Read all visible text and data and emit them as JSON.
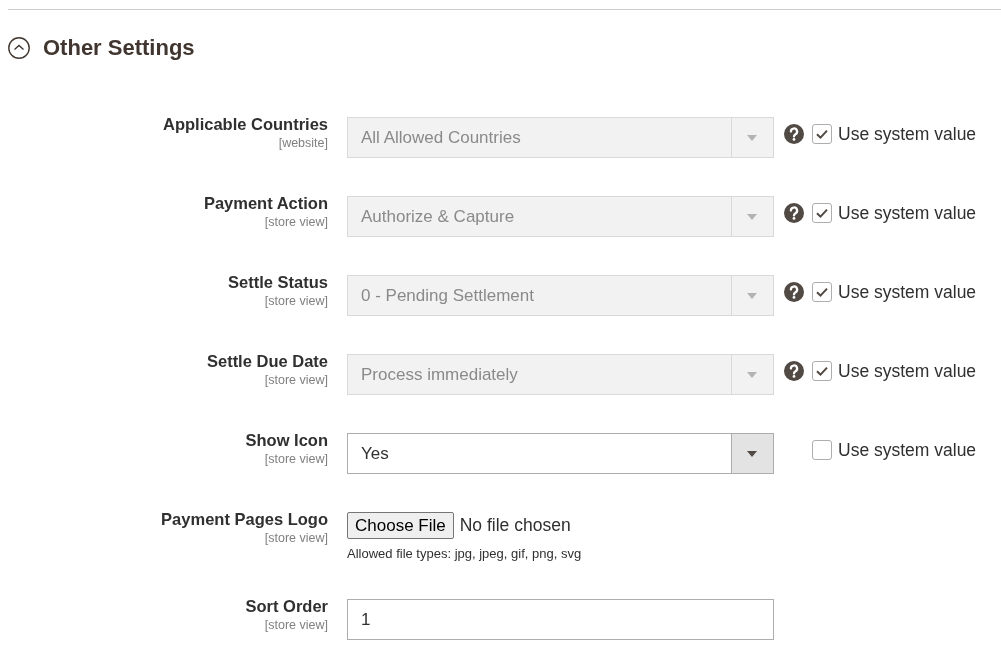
{
  "section": {
    "title": "Other Settings",
    "expanded": true
  },
  "fields": [
    {
      "kind": "select",
      "label": "Applicable Countries",
      "scope": "[website]",
      "value": "All Allowed Countries",
      "disabled": true,
      "help": true,
      "use_system_value": {
        "label": "Use system value",
        "checked": true
      }
    },
    {
      "kind": "select",
      "label": "Payment Action",
      "scope": "[store view]",
      "value": "Authorize & Capture",
      "disabled": true,
      "help": true,
      "use_system_value": {
        "label": "Use system value",
        "checked": true
      }
    },
    {
      "kind": "select",
      "label": "Settle Status",
      "scope": "[store view]",
      "value": "0 - Pending Settlement",
      "disabled": true,
      "help": true,
      "use_system_value": {
        "label": "Use system value",
        "checked": true
      }
    },
    {
      "kind": "select",
      "label": "Settle Due Date",
      "scope": "[store view]",
      "value": "Process immediately",
      "disabled": true,
      "help": true,
      "use_system_value": {
        "label": "Use system value",
        "checked": true
      }
    },
    {
      "kind": "select",
      "label": "Show Icon",
      "scope": "[store view]",
      "value": "Yes",
      "disabled": false,
      "help": false,
      "use_system_value": {
        "label": "Use system value",
        "checked": false
      }
    },
    {
      "kind": "file",
      "label": "Payment Pages Logo",
      "scope": "[store view]",
      "button": "Choose File",
      "status": "No file chosen",
      "note": "Allowed file types: jpg, jpeg, gif, png, svg"
    },
    {
      "kind": "text",
      "label": "Sort Order",
      "scope": "[store view]",
      "value": "1"
    }
  ]
}
